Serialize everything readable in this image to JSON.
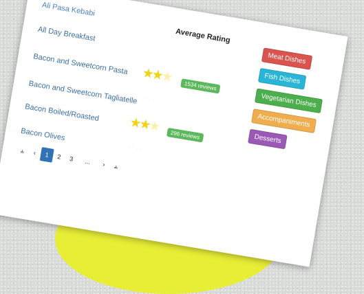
{
  "table": {
    "heading": "Average Rating",
    "rows": [
      {
        "name": "Ali Pasa Kebabi"
      },
      {
        "name": "All Day Breakfast"
      },
      {
        "name": "Bacon and Sweetcorn Pasta",
        "rating": 2.5,
        "reviews": "1534 reviews"
      },
      {
        "name": "Bacon and Sweetcorn Tagliatelle"
      },
      {
        "name": "Bacon Boiled/Roasted",
        "rating": 2.5,
        "reviews": "296 reviews"
      },
      {
        "name": "Bacon Olives"
      }
    ]
  },
  "categories": [
    {
      "label": "Meat Dishes",
      "color": "#d9534f"
    },
    {
      "label": "Fish Dishes",
      "color": "#29b6d6"
    },
    {
      "label": "Vegetarian Dishes",
      "color": "#4cae4c"
    },
    {
      "label": "Accompaniments",
      "color": "#f0ad4e"
    },
    {
      "label": "Desserts",
      "color": "#9b59b6"
    }
  ],
  "pagination": {
    "first": "⫨",
    "prev": "‹",
    "pages": [
      "1",
      "2",
      "3"
    ],
    "active_page": "1",
    "ellipsis": "...",
    "next": "›",
    "last": "⫨"
  },
  "colors": {
    "link": "#3b6fa6",
    "star": "#f3d212",
    "badge": "#5cb85c",
    "active_page": "#3073b5",
    "highlight_blob": "#e8ee36"
  }
}
